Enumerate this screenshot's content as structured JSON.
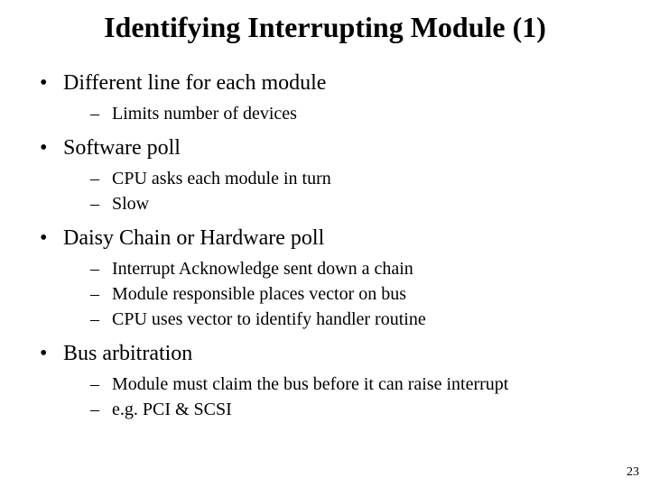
{
  "title": "Identifying Interrupting Module (1)",
  "bullets": [
    {
      "text": "Different line for each module",
      "sub": [
        "Limits number of devices"
      ]
    },
    {
      "text": "Software poll",
      "sub": [
        "CPU asks each module in turn",
        "Slow"
      ]
    },
    {
      "text": "Daisy Chain or Hardware poll",
      "sub": [
        "Interrupt Acknowledge sent down a chain",
        "Module responsible places vector on bus",
        "CPU uses vector to identify handler routine"
      ]
    },
    {
      "text": "Bus arbitration",
      "sub": [
        "Module must claim the bus before it can raise interrupt",
        "e.g. PCI & SCSI"
      ]
    }
  ],
  "page_number": "23"
}
